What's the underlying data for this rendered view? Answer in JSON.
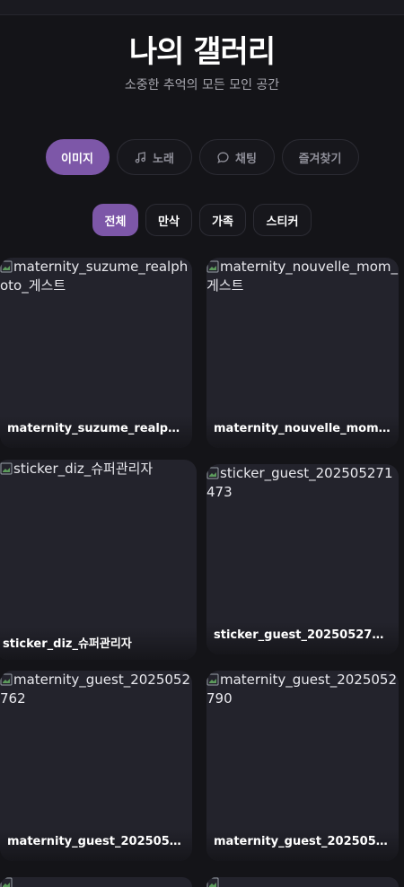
{
  "header": {
    "title": "나의 갤러리",
    "subtitle": "소중한 추억의 모든 모인 공간"
  },
  "tabs": [
    {
      "label": "이미지",
      "icon": "",
      "active": true
    },
    {
      "label": "노래",
      "icon": "music-note-icon",
      "active": false
    },
    {
      "label": "채팅",
      "icon": "chat-bubble-icon",
      "active": false
    },
    {
      "label": "즐겨찾기",
      "icon": "",
      "active": false
    }
  ],
  "filters": [
    {
      "label": "전체",
      "active": true
    },
    {
      "label": "만삭",
      "active": false
    },
    {
      "label": "가족",
      "active": false
    },
    {
      "label": "스티커",
      "active": false
    }
  ],
  "gallery": [
    {
      "alt": "maternity_suzume_realphoto_게스트",
      "caption": "maternity_suzume_realpho..."
    },
    {
      "alt": "maternity_nouvelle_mom_게스트",
      "caption": "maternity_nouvelle_mom_..."
    },
    {
      "alt": "sticker_diz_슈퍼관리자",
      "caption": "sticker_diz_슈퍼관리자"
    },
    {
      "alt": "sticker_guest_202505271473",
      "caption": "sticker_guest_202505271473"
    },
    {
      "alt": "maternity_guest_2025052762",
      "caption": "maternity_guest_20250527..."
    },
    {
      "alt": "maternity_guest_2025052790",
      "caption": "maternity_guest_20250527..."
    }
  ],
  "colors": {
    "accent": "#7d57a8",
    "background": "#141418",
    "card": "#23232c"
  }
}
